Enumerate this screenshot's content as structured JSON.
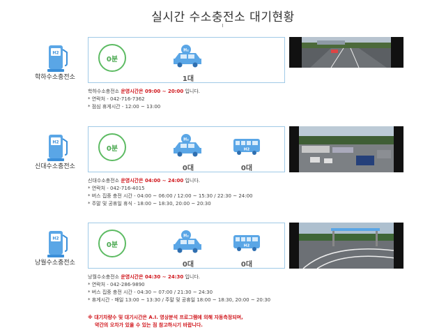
{
  "page": {
    "title": "실시간 수소충전소 대기현황"
  },
  "stations": [
    {
      "name": "학하수소충전소",
      "wait_time": "0분",
      "car_count": "1대",
      "info_prefix": "학하수소충전소 ",
      "info_hours": "운영시간은 09:00 ~ 20:00",
      "info_suffix": " 입니다.",
      "lines": [
        "* 연락처 - 042-716-7362",
        "* 점심 휴게시간 - 12:00 ~ 13:00"
      ]
    },
    {
      "name": "신대수소충전소",
      "wait_time": "0분",
      "car_count": "0대",
      "bus_count": "0대",
      "info_prefix": "신대수소충전소 ",
      "info_hours": "운영시간은 04:00 ~ 24:00",
      "info_suffix": " 입니다.",
      "lines": [
        "* 연락처 - 042-716-4015",
        "* 버스 집중 충전 시간 - 04:00 ~ 06:00 / 12:00 ~ 15:30 / 22:30 ~ 24:00",
        "* 주말 및 공휴일 휴식 - 18:00 ~ 18:30, 20:00 ~ 20:30"
      ]
    },
    {
      "name": "낭월수소충전소",
      "wait_time": "0분",
      "car_count": "0대",
      "bus_count": "0대",
      "info_prefix": "낭월수소충전소 ",
      "info_hours": "운영시간은 04:30 ~ 24:30",
      "info_suffix": " 입니다.",
      "lines": [
        "* 연락처 - 042-286-9890",
        "* 버스 집중 충전 시간 - 04:30 ~ 07:00 / 21:30 ~ 24:30",
        "* 휴게시간 - 매일 13:00 ~ 13:30 / 주말 및 공휴일 18:00 ~ 18:30, 20:00 ~ 20:30"
      ]
    }
  ],
  "icons": {
    "h2_label": "H2",
    "h2_small": "H₂"
  },
  "notice": [
    "※ 대기차량수 및 대기시간은 A.I. 영상분석 프로그램에 의해 자동측정되며,",
    "약간의 오차가 있을 수 있는 점 참고하시기 바랍니다."
  ],
  "colors": {
    "accent_blue": "#3b8fd9",
    "green": "#5dbb63",
    "red": "#d0161c"
  }
}
